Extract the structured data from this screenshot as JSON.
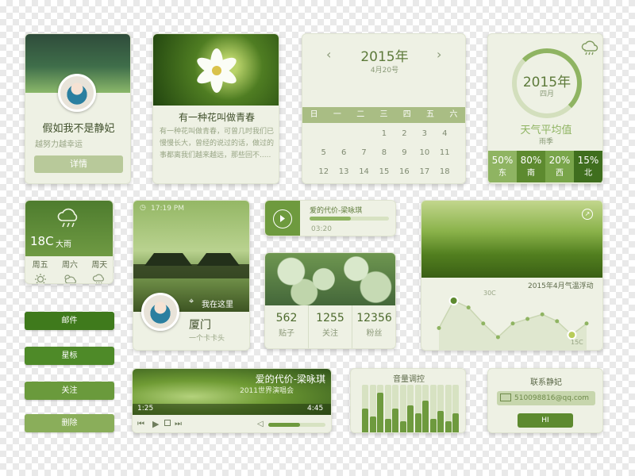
{
  "profile": {
    "name": "假如我不是静妃",
    "tagline": "越努力越幸运",
    "detail_button": "详情"
  },
  "flower": {
    "title": "有一种花叫做青春",
    "body": "有一种花叫做青春，可曾几时我们已慢慢长大，曾经的说过的话，做过的事都离我们越来越远，那些回不....."
  },
  "calendar": {
    "year": "2015年",
    "date": "4月20号",
    "weekdays": [
      "日",
      "一",
      "二",
      "三",
      "四",
      "五",
      "六"
    ],
    "rows": [
      [
        "",
        "",
        "",
        "1",
        "2",
        "3",
        "4"
      ],
      [
        "5",
        "6",
        "7",
        "8",
        "9",
        "10",
        "11"
      ],
      [
        "12",
        "13",
        "14",
        "15",
        "16",
        "17",
        "18"
      ],
      [
        "19",
        "20",
        "21",
        "22",
        "23",
        "24",
        "25"
      ],
      [
        "26",
        "27",
        "28",
        "29",
        "30",
        "",
        ""
      ]
    ],
    "selected": "20"
  },
  "weather_avg": {
    "year": "2015年",
    "month": "四月",
    "title": "天气平均值",
    "season": "雨季",
    "directions": [
      {
        "value": "50%",
        "label": "东",
        "color": "#8fb462"
      },
      {
        "value": "80%",
        "label": "南",
        "color": "#5d8a2f"
      },
      {
        "value": "20%",
        "label": "西",
        "color": "#79a54a"
      },
      {
        "value": "15%",
        "label": "北",
        "color": "#3f6e1e"
      }
    ]
  },
  "weather_small": {
    "temp": "18C",
    "condition": "大雨",
    "days": [
      {
        "day": "周五",
        "icon": "sun-icon"
      },
      {
        "day": "周六",
        "icon": "partly-cloudy-icon"
      },
      {
        "day": "周天",
        "icon": "rain-cloud-icon"
      }
    ]
  },
  "location": {
    "time": "17:19 PM",
    "here": "我在这里",
    "city": "厦门",
    "subtitle": "一个卡卡头"
  },
  "song_mini": {
    "title": "爱的代价-梁咏琪",
    "time": "03:20",
    "progress": 0.52
  },
  "social": {
    "stats": [
      {
        "value": "562",
        "label": "贴子"
      },
      {
        "value": "1255",
        "label": "关注"
      },
      {
        "value": "12356",
        "label": "粉丝"
      }
    ]
  },
  "temperature": {
    "title": "2015年4月气温浮动",
    "high": "30C",
    "low": "15C",
    "points": [
      18,
      30,
      27,
      20,
      14,
      20,
      22,
      24,
      21,
      15,
      20
    ]
  },
  "side_buttons": [
    {
      "label": "邮件",
      "color": "#3f7a1c"
    },
    {
      "label": "星标",
      "color": "#4e8a28"
    },
    {
      "label": "关注",
      "color": "#6a9a3c"
    },
    {
      "label": "删除",
      "color": "#8aae5a"
    }
  ],
  "player": {
    "title": "爱的代价-梁咏琪",
    "subtitle": "2011世界演唱会",
    "elapsed": "1:25",
    "total": "4:45",
    "progress": 0.3,
    "volume": 0.55
  },
  "volume_ctrl": {
    "title": "音量调控",
    "levels": [
      0.55,
      0.4,
      0.85,
      0.35,
      0.55,
      0.3,
      0.6,
      0.45,
      0.7,
      0.35,
      0.5,
      0.3,
      0.45
    ]
  },
  "contact": {
    "title": "联系静妃",
    "email": "510098816@qq.com",
    "button": "HI"
  }
}
